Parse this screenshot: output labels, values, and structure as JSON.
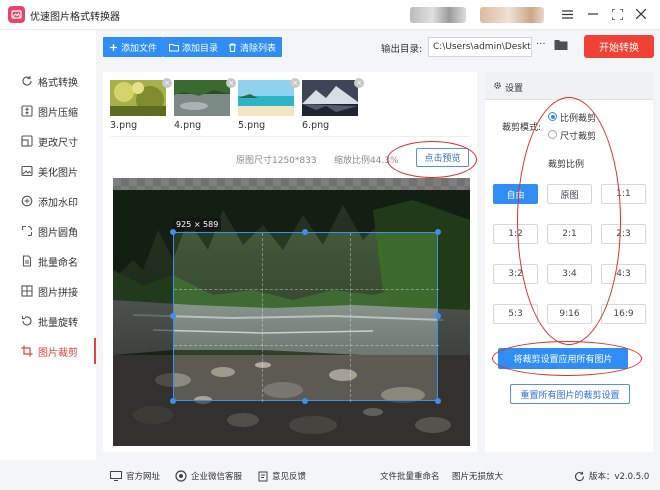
{
  "app": {
    "title": "优速图片格式转换器"
  },
  "toolbar": {
    "add_file": "添加文件",
    "add_dir": "添加目录",
    "clear_list": "清除列表",
    "output_label": "输出目录:",
    "output_path": "C:\\Users\\admin\\Deskto",
    "more": "···",
    "start": "开始转换"
  },
  "sidebar": {
    "items": [
      {
        "label": "格式转换"
      },
      {
        "label": "图片压缩"
      },
      {
        "label": "更改尺寸"
      },
      {
        "label": "美化图片"
      },
      {
        "label": "添加水印"
      },
      {
        "label": "图片圆角"
      },
      {
        "label": "批量命名"
      },
      {
        "label": "图片拼接"
      },
      {
        "label": "批量旋转"
      },
      {
        "label": "图片裁剪"
      }
    ],
    "active_index": 9
  },
  "thumbs": [
    {
      "label": "3.png"
    },
    {
      "label": "4.png"
    },
    {
      "label": "5.png"
    },
    {
      "label": "6.png"
    }
  ],
  "preview": {
    "orig_size": "原图尺寸1250*833",
    "zoom": "缩放比例44.3%",
    "preview_btn": "点击预览",
    "crop_size": "925 × 589"
  },
  "settings": {
    "title": "设置",
    "mode_label": "裁剪模式:",
    "mode_ratio": "比例裁剪",
    "mode_size": "尺寸裁剪",
    "ratio_title": "裁剪比例",
    "ratios": [
      "自由",
      "原图",
      "1:1",
      "1:2",
      "2:1",
      "2:3",
      "3:2",
      "3:4",
      "4:3",
      "5:3",
      "9:16",
      "16:9"
    ],
    "apply_all": "将裁剪设置应用所有图片",
    "reset_all": "重置所有图片的裁剪设置"
  },
  "footer": {
    "website": "官方网址",
    "wechat": "企业微信客服",
    "feedback": "意见反馈",
    "batch_rename": "文件批量重命名",
    "lossless": "图片无损放大",
    "version": "版本：v2.0.5.0"
  },
  "colors": {
    "accent": "#2f8df4",
    "start": "#ef4135",
    "active_nav": "#e5413c",
    "annotation": "#d9302a"
  }
}
